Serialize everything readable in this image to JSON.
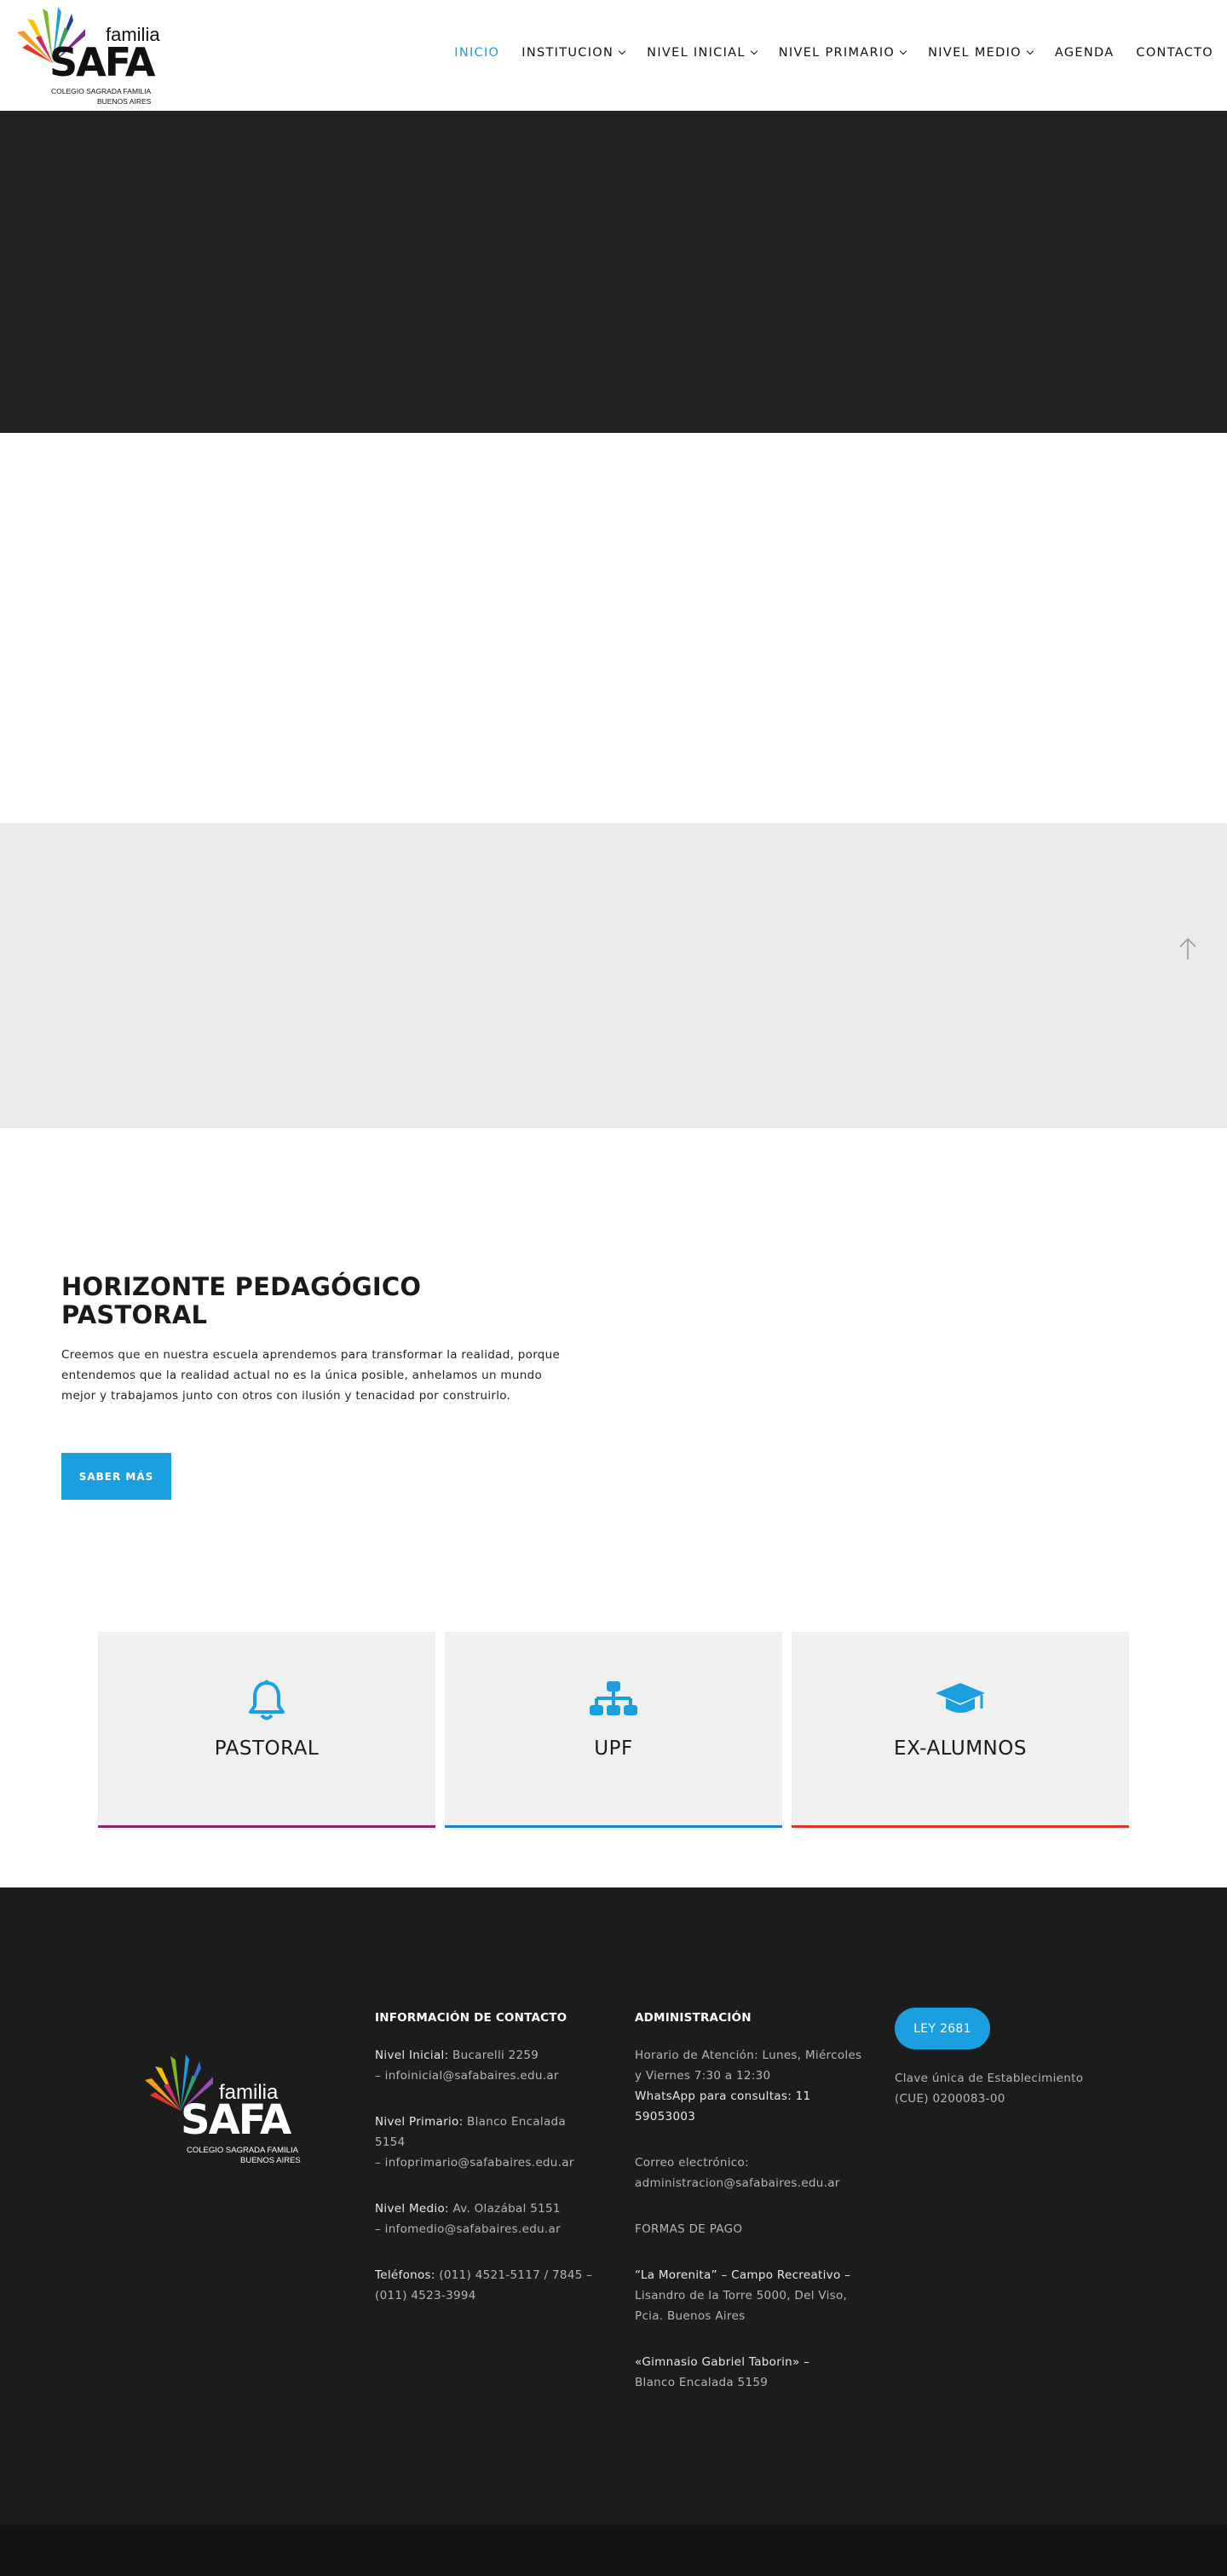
{
  "brand": {
    "familia": "familia",
    "safa": "SAFA",
    "subtitle1": "COLEGIO SAGRADA FAMILIA",
    "subtitle2": "BUENOS AIRES"
  },
  "nav": {
    "items": [
      {
        "label": "INICIO",
        "active": true,
        "dropdown": false
      },
      {
        "label": "INSTITUCION",
        "active": false,
        "dropdown": true
      },
      {
        "label": "NIVEL INICIAL",
        "active": false,
        "dropdown": true
      },
      {
        "label": "NIVEL PRIMARIO",
        "active": false,
        "dropdown": true
      },
      {
        "label": "NIVEL MEDIO",
        "active": false,
        "dropdown": true
      },
      {
        "label": "AGENDA",
        "active": false,
        "dropdown": false
      },
      {
        "label": "CONTACTO",
        "active": false,
        "dropdown": false
      }
    ],
    "active_color": "#1aa0d8"
  },
  "horizonte": {
    "title": "HORIZONTE PEDAGÓGICO PASTORAL",
    "text": "Creemos que en nuestra escuela aprendemos para transformar la realidad, porque entendemos que la realidad actual no es la única posible, anhelamos un mundo mejor y trabajamos junto con otros con ilusión y tenacidad por construirlo.",
    "button": "SABER MÁS"
  },
  "cards": [
    {
      "label": "PASTORAL",
      "icon": "bell-icon",
      "bar_color": "#8b2a6e"
    },
    {
      "label": "UPF",
      "icon": "sitemap-icon",
      "bar_color": "#1a7fd0"
    },
    {
      "label": "EX-ALUMNOS",
      "icon": "graduation-cap-icon",
      "bar_color": "#d43a2a"
    }
  ],
  "footer": {
    "contact": {
      "heading": "INFORMACIÓN DE CONTACTO",
      "inicial_label": "Nivel Inicial:",
      "inicial_addr": "Bucarelli 2259",
      "inicial_mail": "– infoinicial@safabaires.edu.ar",
      "primario_label": "Nivel Primario:",
      "primario_addr": "Blanco Encalada 5154",
      "primario_mail": "– infoprimario@safabaires.edu.ar",
      "medio_label": "Nivel Medio:",
      "medio_addr": "Av. Olazábal 5151",
      "medio_mail": "– infomedio@safabaires.edu.ar",
      "tel_label": "Teléfonos:",
      "tel_values": "(011) 4521-5117 / 7845 – (011) 4523-3994"
    },
    "admin": {
      "heading": "ADMINISTRACIÓN",
      "horario": "Horario de Atención: Lunes, Miércoles y Viernes 7:30 a 12:30",
      "whatsapp": "WhatsApp para consultas: 11 59053003",
      "correo_label": "Correo electrónico:",
      "correo": "administracion@safabaires.edu.ar",
      "formas": "FORMAS DE PAGO",
      "morenita_name": "“La Morenita” – Campo Recreativo –",
      "morenita_addr": "Lisandro de la Torre 5000, Del Viso, Pcia. Buenos Aires",
      "gimnasio_name": "«Gimnasio Gabriel Taborin» –",
      "gimnasio_addr": "Blanco Encalada 5159"
    },
    "ley": {
      "button": "LEY 2681",
      "cue": "Clave única de Establecimiento (CUE) 0200083-00"
    }
  },
  "colors": {
    "accent": "#1a9fe0",
    "hero_bg": "#222222",
    "gray_band": "#ebebeb",
    "footer_bg": "#1c1c1c"
  }
}
